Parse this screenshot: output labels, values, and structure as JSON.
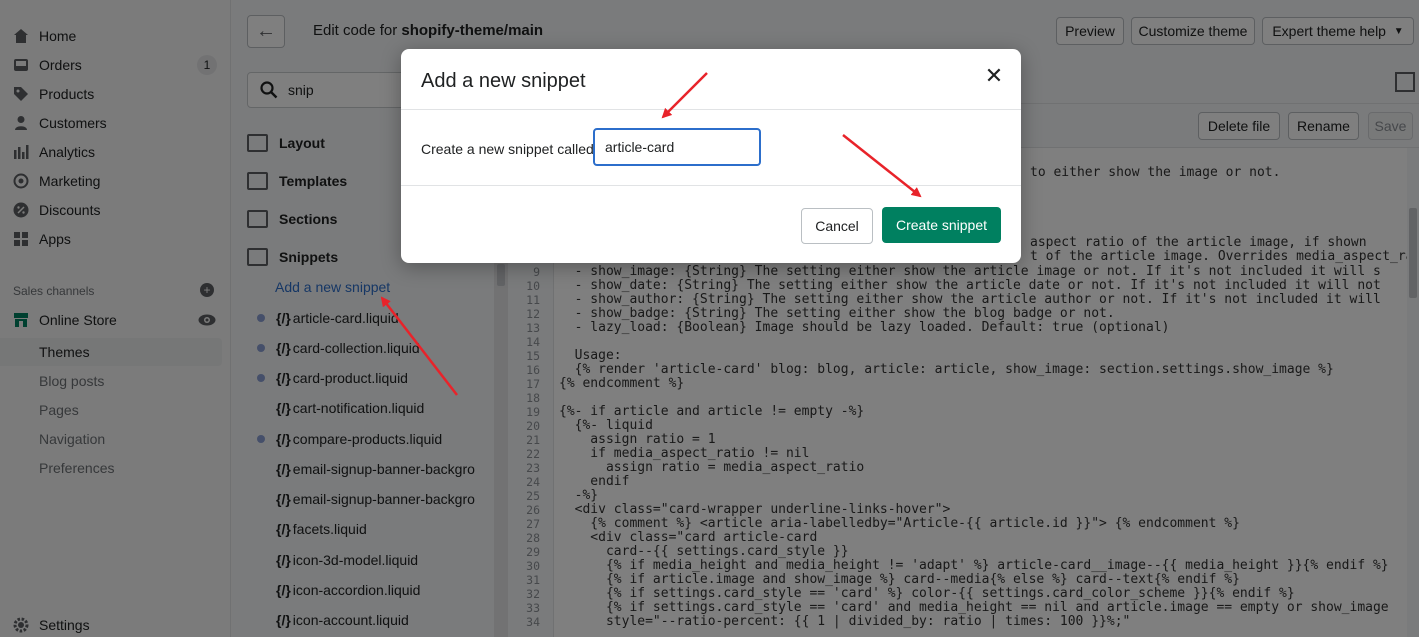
{
  "admin_nav": {
    "items": [
      {
        "label": "Home",
        "icon": "home-icon"
      },
      {
        "label": "Orders",
        "icon": "orders-icon",
        "badge": "1"
      },
      {
        "label": "Products",
        "icon": "tag-icon"
      },
      {
        "label": "Customers",
        "icon": "person-icon"
      },
      {
        "label": "Analytics",
        "icon": "bar-chart-icon"
      },
      {
        "label": "Marketing",
        "icon": "target-icon"
      },
      {
        "label": "Discounts",
        "icon": "discount-icon"
      },
      {
        "label": "Apps",
        "icon": "apps-icon"
      }
    ],
    "sales_channels_label": "Sales channels",
    "online_store_label": "Online Store",
    "sub_items": [
      "Themes",
      "Blog posts",
      "Pages",
      "Navigation",
      "Preferences"
    ],
    "settings_label": "Settings"
  },
  "topbar": {
    "title_prefix": "Edit code for ",
    "title_theme": "shopify-theme/main",
    "preview_label": "Preview",
    "customize_label": "Customize theme",
    "expert_help_label": "Expert theme help"
  },
  "file_panel": {
    "search_value": "snip",
    "folders": [
      "Layout",
      "Templates",
      "Sections",
      "Snippets"
    ],
    "add_snippet_label": "Add a new snippet",
    "files": [
      {
        "name": "article-card.liquid",
        "modified": true
      },
      {
        "name": "card-collection.liquid",
        "modified": true
      },
      {
        "name": "card-product.liquid",
        "modified": true
      },
      {
        "name": "cart-notification.liquid",
        "modified": false
      },
      {
        "name": "compare-products.liquid",
        "modified": true
      },
      {
        "name": "email-signup-banner-backgro",
        "modified": false
      },
      {
        "name": "email-signup-banner-backgro",
        "modified": false
      },
      {
        "name": "facets.liquid",
        "modified": false
      },
      {
        "name": "icon-3d-model.liquid",
        "modified": false
      },
      {
        "name": "icon-accordion.liquid",
        "modified": false
      },
      {
        "name": "icon-account.liquid",
        "modified": false
      }
    ]
  },
  "code_actions": {
    "delete_label": "Delete file",
    "rename_label": "Rename",
    "save_label": "Save"
  },
  "code": {
    "visible_fragments": [
      "to either show the image or not.",
      "aspect ratio of the article image, if shown",
      "t of the article image. Overrides media_aspect_rat"
    ],
    "lines": [
      {
        "n": "9",
        "t": "  - show_image: {String} The setting either show the article image or not. If it's not included it will s"
      },
      {
        "n": "10",
        "t": "  - show_date: {String} The setting either show the article date or not. If it's not included it will not"
      },
      {
        "n": "11",
        "t": "  - show_author: {String} The setting either show the article author or not. If it's not included it will"
      },
      {
        "n": "12",
        "t": "  - show_badge: {String} The setting either show the blog badge or not."
      },
      {
        "n": "13",
        "t": "  - lazy_load: {Boolean} Image should be lazy loaded. Default: true (optional)"
      },
      {
        "n": "14",
        "t": ""
      },
      {
        "n": "15",
        "t": "  Usage:"
      },
      {
        "n": "16",
        "t": "  {% render 'article-card' blog: blog, article: article, show_image: section.settings.show_image %}"
      },
      {
        "n": "17",
        "t": "{% endcomment %}"
      },
      {
        "n": "18",
        "t": ""
      },
      {
        "n": "19",
        "t": "{%- if article and article != empty -%}"
      },
      {
        "n": "20",
        "t": "  {%- liquid"
      },
      {
        "n": "21",
        "t": "    assign ratio = 1"
      },
      {
        "n": "22",
        "t": "    if media_aspect_ratio != nil"
      },
      {
        "n": "23",
        "t": "      assign ratio = media_aspect_ratio"
      },
      {
        "n": "24",
        "t": "    endif"
      },
      {
        "n": "25",
        "t": "  -%}"
      },
      {
        "n": "26",
        "t": "  <div class=\"card-wrapper underline-links-hover\">"
      },
      {
        "n": "27",
        "t": "    {% comment %} <article aria-labelledby=\"Article-{{ article.id }}\"> {% endcomment %}"
      },
      {
        "n": "28",
        "t": "    <div class=\"card article-card"
      },
      {
        "n": "29",
        "t": "      card--{{ settings.card_style }}"
      },
      {
        "n": "30",
        "t": "      {% if media_height and media_height != 'adapt' %} article-card__image--{{ media_height }}{% endif %}"
      },
      {
        "n": "31",
        "t": "      {% if article.image and show_image %} card--media{% else %} card--text{% endif %}"
      },
      {
        "n": "32",
        "t": "      {% if settings.card_style == 'card' %} color-{{ settings.card_color_scheme }}{% endif %}"
      },
      {
        "n": "33",
        "t": "      {% if settings.card_style == 'card' and media_height == nil and article.image == empty or show_image"
      },
      {
        "n": "34",
        "t": "      style=\"--ratio-percent: {{ 1 | divided_by: ratio | times: 100 }}%;\""
      }
    ]
  },
  "modal": {
    "title": "Add a new snippet",
    "label": "Create a new snippet called",
    "input_value": "article-card",
    "cancel_label": "Cancel",
    "create_label": "Create snippet",
    "close_icon": "close-icon"
  },
  "colors": {
    "primary": "#008060",
    "link": "#2c6ecb",
    "arrow": "#e8232a"
  }
}
